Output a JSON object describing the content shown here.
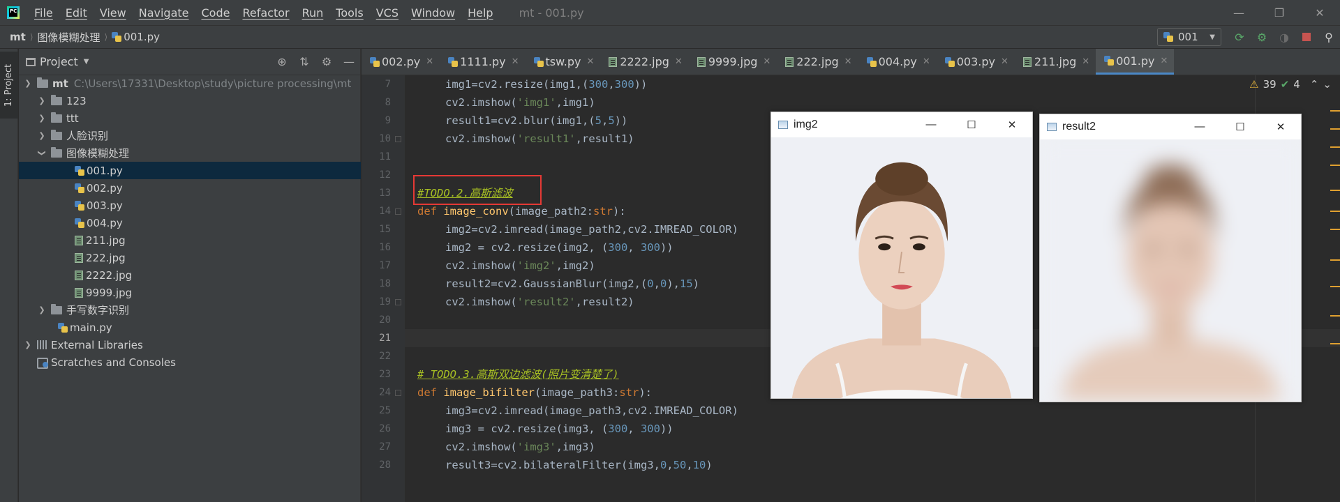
{
  "app": {
    "logo_text": "PC",
    "menu": [
      "File",
      "Edit",
      "View",
      "Navigate",
      "Code",
      "Refactor",
      "Run",
      "Tools",
      "VCS",
      "Window",
      "Help"
    ],
    "window_title": "mt - 001.py"
  },
  "navbar": {
    "breadcrumbs": [
      "mt",
      "图像模糊处理",
      "001.py"
    ],
    "run_config": "001"
  },
  "left_stripe": {
    "project_tab": "1: Project"
  },
  "project_panel": {
    "title": "Project",
    "tree": [
      {
        "label": "mt",
        "path": "C:\\Users\\17331\\Desktop\\study\\picture processing\\mt"
      },
      {
        "label": "123"
      },
      {
        "label": "ttt"
      },
      {
        "label": "人脸识别"
      },
      {
        "label": "图像模糊处理"
      },
      {
        "label": "001.py"
      },
      {
        "label": "002.py"
      },
      {
        "label": "003.py"
      },
      {
        "label": "004.py"
      },
      {
        "label": "211.jpg"
      },
      {
        "label": "222.jpg"
      },
      {
        "label": "2222.jpg"
      },
      {
        "label": "9999.jpg"
      },
      {
        "label": "手写数字识别"
      },
      {
        "label": "main.py"
      },
      {
        "label": "External Libraries"
      },
      {
        "label": "Scratches and Consoles"
      }
    ]
  },
  "tabs": [
    "002.py",
    "1111.py",
    "tsw.py",
    "2222.jpg",
    "9999.jpg",
    "222.jpg",
    "004.py",
    "003.py",
    "211.jpg",
    "001.py"
  ],
  "editor": {
    "inspection": {
      "warnings": "39",
      "weak_warnings": "4"
    },
    "line_numbers": [
      "7",
      "8",
      "9",
      "10",
      "11",
      "12",
      "13",
      "14",
      "15",
      "16",
      "17",
      "18",
      "19",
      "20",
      "21",
      "22",
      "23",
      "24",
      "25",
      "26",
      "27",
      "28"
    ],
    "code": [
      "img1=cv2.resize(img1,(300,300))",
      "cv2.imshow('img1',img1)",
      "result1=cv2.blur(img1,(5,5))",
      "cv2.imshow('result1',result1)",
      "",
      "",
      "#TODO.2.高斯滤波",
      "def image_conv(image_path2:str):",
      "img2=cv2.imread(image_path2,cv2.IMREAD_COLOR)",
      "img2 = cv2.resize(img2, (300, 300))",
      "cv2.imshow('img2',img2)",
      "result2=cv2.GaussianBlur(img2,(0,0),15)",
      "cv2.imshow('result2',result2)",
      "",
      "",
      "",
      "# TODO.3.高斯双边滤波(照片变清楚了)",
      "def image_bifilter(image_path3:str):",
      "img3=cv2.imread(image_path3,cv2.IMREAD_COLOR)",
      "img3 = cv2.resize(img3, (300, 300))",
      "cv2.imshow('img3',img3)",
      "result3=cv2.bilateralFilter(img3,0,50,10)"
    ]
  },
  "windows": {
    "img2": {
      "title": "img2"
    },
    "result2": {
      "title": "result2"
    }
  },
  "colors": {
    "accent": "#4a88c7",
    "highlight_box": "#e53935",
    "keyword": "#cc7832",
    "string": "#6a8759",
    "number": "#6897bb",
    "todo": "#a8c023"
  }
}
